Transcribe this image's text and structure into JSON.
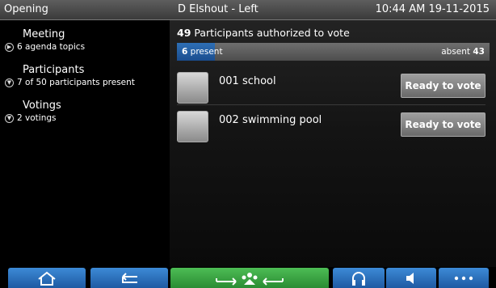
{
  "topbar": {
    "left": "Opening",
    "center": "D Elshout - Left",
    "right": "10:44 AM 19-11-2015"
  },
  "sidebar": {
    "sections": [
      {
        "title": "Meeting",
        "subtitle": "6 agenda topics",
        "icon": "chevron-right-circle-icon"
      },
      {
        "title": "Participants",
        "subtitle": "7 of 50 participants present",
        "icon": "chevron-down-circle-icon"
      },
      {
        "title": "Votings",
        "subtitle": "2 votings",
        "icon": "chevron-down-circle-icon"
      }
    ]
  },
  "main": {
    "authorized_count": "49",
    "authorized_text": "Participants authorized to vote",
    "present_count": "6",
    "present_label": "present",
    "absent_label": "absent",
    "absent_count": "43",
    "present_fraction": 0.122,
    "participants": [
      {
        "label": "001  school",
        "button": "Ready to vote"
      },
      {
        "label": "002  swimming pool",
        "button": "Ready to vote"
      }
    ]
  },
  "bottombar": {
    "buttons": [
      {
        "name": "home-icon",
        "color": "blue"
      },
      {
        "name": "back-arrow-icon",
        "color": "blue"
      },
      {
        "name": "transfer-vote-icon",
        "color": "green"
      },
      {
        "name": "headphones-icon",
        "color": "blue"
      },
      {
        "name": "speaker-icon",
        "color": "blue"
      },
      {
        "name": "more-icon",
        "color": "blue"
      }
    ]
  },
  "colors": {
    "accent_blue": "#1e5aa3",
    "accent_green": "#2a8c33",
    "bar_gray": "#5e5e5e"
  }
}
